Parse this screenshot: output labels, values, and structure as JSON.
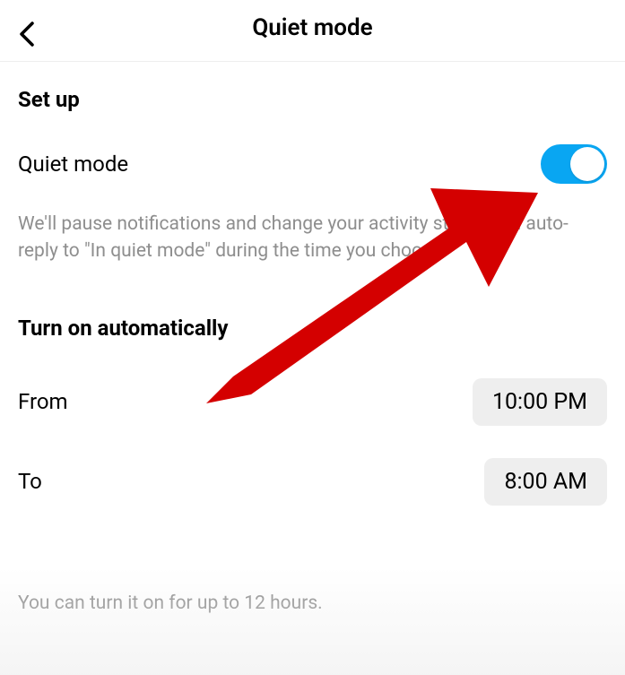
{
  "header": {
    "title": "Quiet mode"
  },
  "setup": {
    "heading": "Set up",
    "toggle_label": "Quiet mode",
    "toggle_on": true,
    "description": "We'll pause notifications and change your activity status and auto-reply to \"In quiet mode\" during the time you choose."
  },
  "schedule": {
    "heading": "Turn on automatically",
    "from_label": "From",
    "from_value": "10:00 PM",
    "to_label": "To",
    "to_value": "8:00 AM"
  },
  "footer": {
    "note": "You can turn it on for up to 12 hours."
  },
  "annotation": {
    "arrow_color": "#d40000"
  }
}
